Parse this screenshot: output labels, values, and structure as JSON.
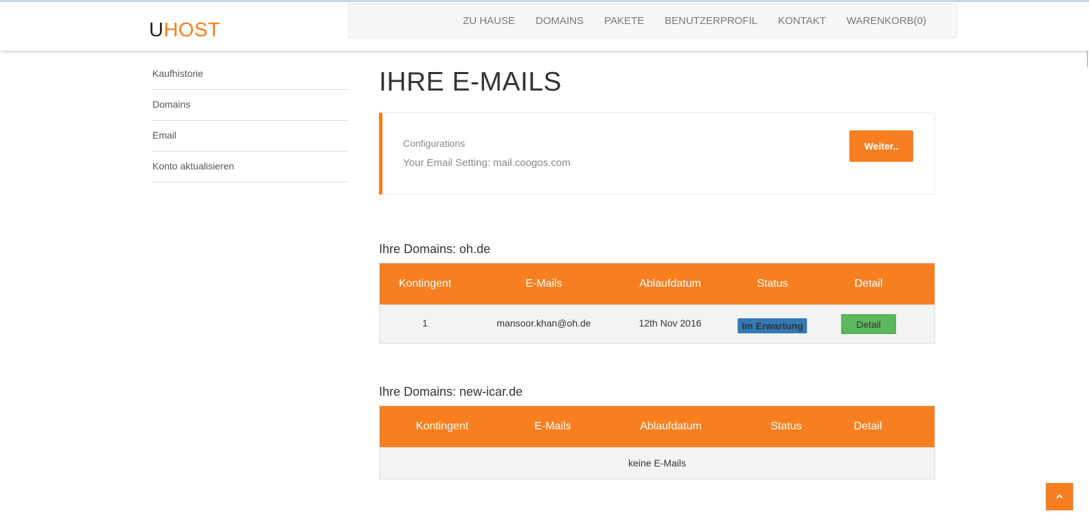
{
  "logo": {
    "u": "U",
    "host": "HOST"
  },
  "nav": {
    "items": [
      {
        "label": "ZU HAUSE"
      },
      {
        "label": "DOMAINS"
      },
      {
        "label": "PAKETE"
      },
      {
        "label": "BENUTZERPROFIL"
      },
      {
        "label": "KONTAKT"
      },
      {
        "label": "WARENKORB(0)"
      }
    ]
  },
  "sidebar": {
    "items": [
      {
        "label": "Kaufhistorie"
      },
      {
        "label": "Domains"
      },
      {
        "label": "Email"
      },
      {
        "label": "Konto aktualisieren"
      }
    ]
  },
  "page": {
    "title": "IHRE E-MAILS"
  },
  "config": {
    "label": "Configurations",
    "setting": "Your Email Setting: mail.coogos.com",
    "button": "Weiter.."
  },
  "domains": [
    {
      "title": "Ihre Domains: oh.de",
      "columns": [
        "Kontingent",
        "E-Mails",
        "Ablaufdatum",
        "Status",
        "Detail"
      ],
      "rows": [
        {
          "kontingent": "1",
          "email": "mansoor.khan@oh.de",
          "ablaufdatum": "12th Nov 2016",
          "status": "Im Erwartung",
          "detail": "Detail"
        }
      ]
    },
    {
      "title": "Ihre Domains: new-icar.de",
      "columns": [
        "Kontingent",
        "E-Mails",
        "Ablaufdatum",
        "Status",
        "Detail"
      ],
      "empty": "keine E-Mails"
    }
  ],
  "colors": {
    "accent": "#f77f1f",
    "status_badge": "#337ab7",
    "detail_button": "#5cb85c"
  },
  "icons": {
    "scroll_top": "chevron-up-icon"
  }
}
